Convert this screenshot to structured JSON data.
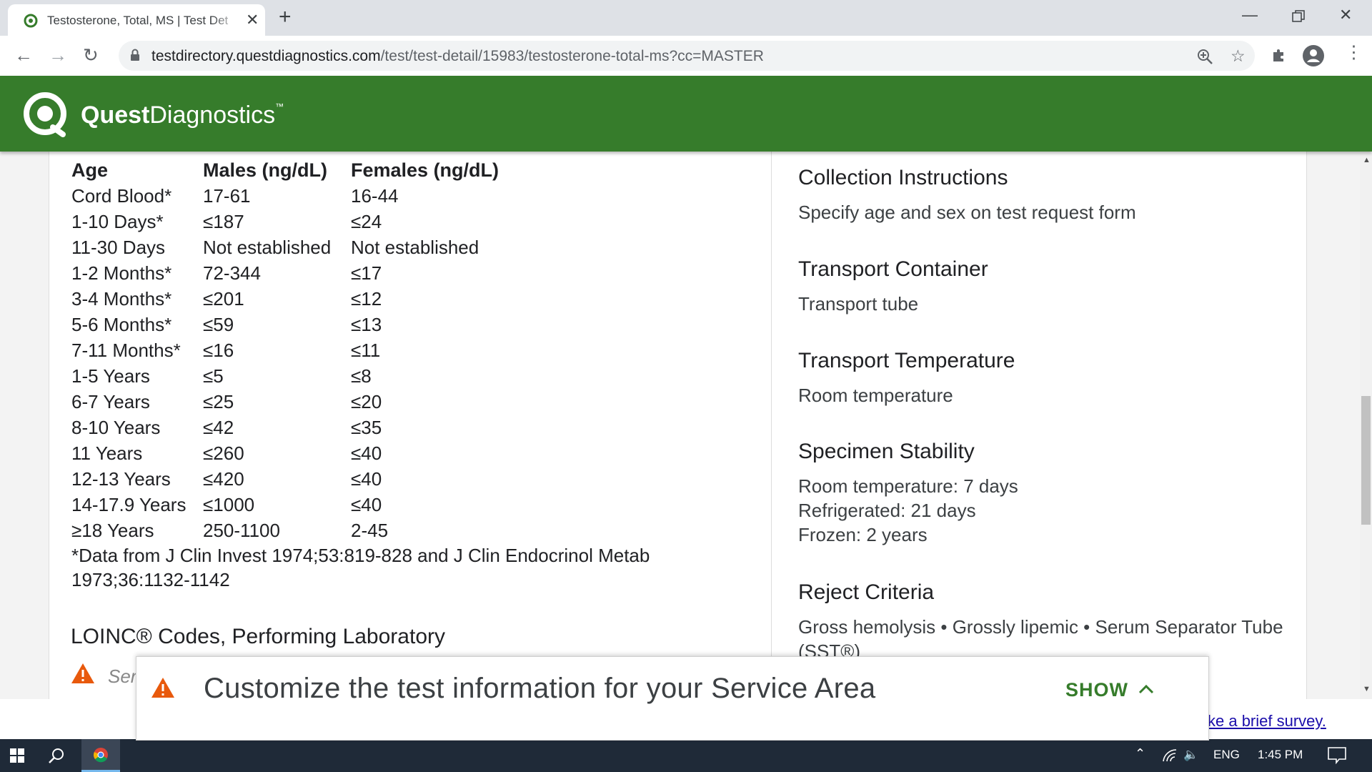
{
  "browser": {
    "tab_title": "Testosterone, Total, MS | Test Det",
    "url_host": "testdirectory.questdiagnostics.com",
    "url_path": "/test/test-detail/15983/testosterone-total-ms?cc=MASTER"
  },
  "site": {
    "logo_bold": "Quest",
    "logo_light": "Diagnostics",
    "logo_tm": "™"
  },
  "reference_table": {
    "headers": [
      "Age",
      "Males (ng/dL)",
      "Females (ng/dL)"
    ],
    "rows": [
      [
        "Cord Blood*",
        " 17-61",
        " 16-44"
      ],
      [
        "1-10 Days*",
        " ≤187",
        " ≤24"
      ],
      [
        "11-30 Days",
        "Not established",
        "Not established"
      ],
      [
        "1-2 Months*",
        " 72-344",
        " ≤17"
      ],
      [
        "3-4 Months*",
        " ≤201",
        " ≤12"
      ],
      [
        "5-6 Months*",
        " ≤59",
        " ≤13"
      ],
      [
        "7-11 Months*",
        " ≤16",
        " ≤11"
      ],
      [
        "1-5 Years",
        " ≤5",
        " ≤8"
      ],
      [
        "6-7 Years",
        " ≤25",
        " ≤20"
      ],
      [
        "8-10 Years",
        " ≤42",
        " ≤35"
      ],
      [
        "11 Years",
        " ≤260",
        " ≤40"
      ],
      [
        "12-13 Years",
        " ≤420",
        " ≤40"
      ],
      [
        "14-17.9 Years",
        " ≤1000",
        " ≤40"
      ],
      [
        "≥18 Years",
        " 250-1100",
        " 2-45"
      ]
    ],
    "footnote": "*Data from J Clin Invest 1974;53:819-828 and J Clin Endocrinol Metab 1973;36:1132-1142"
  },
  "loinc": {
    "title": "LOINC® Codes, Performing Laboratory",
    "partial_text": "Ser"
  },
  "right_sections": {
    "collection": {
      "title": "Collection Instructions",
      "body": "Specify age and sex on test request form"
    },
    "container": {
      "title": "Transport Container",
      "body": "Transport tube"
    },
    "temperature": {
      "title": "Transport Temperature",
      "body": "Room temperature"
    },
    "stability": {
      "title": "Specimen Stability",
      "line1": "Room temperature: 7 days",
      "line2": "Refrigerated: 21 days",
      "line3": "Frozen: 2 years"
    },
    "reject": {
      "title": "Reject Criteria",
      "body": "Gross hemolysis • Grossly lipemic • Serum Separator Tube (SST®)"
    }
  },
  "banner": {
    "text": "Customize the test information for your Service Area",
    "show_label": "SHOW"
  },
  "survey": {
    "link_text": "ke a brief survey."
  },
  "taskbar": {
    "language": "ENG",
    "time": "1:45 PM"
  },
  "colors": {
    "brand_green": "#367c2b",
    "warning_orange": "#e8590c",
    "taskbar": "#1f2a38"
  }
}
